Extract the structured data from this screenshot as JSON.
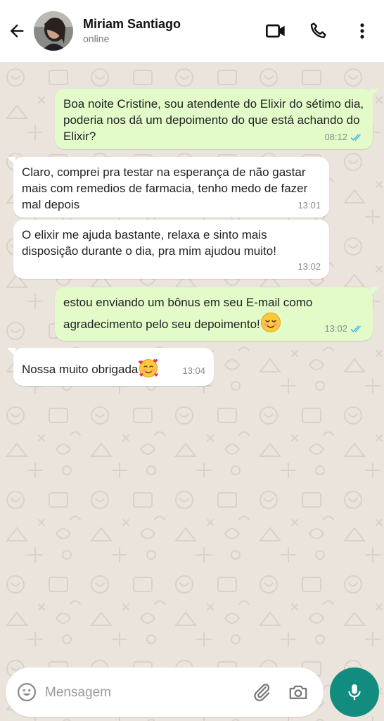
{
  "header": {
    "contact_name": "Miriam Santiago",
    "status": "online"
  },
  "messages": [
    {
      "direction": "outgoing",
      "text": "Boa noite Cristine, sou atendente do Elixir do sétimo dia, poderia nos dá um depoimento do que está achando do Elixir?",
      "time": "08:12",
      "read": true
    },
    {
      "direction": "incoming",
      "text": "Claro, comprei pra testar na esperança de não gastar mais com remedios de farmacia, tenho medo de fazer mal depois",
      "time": "13:01"
    },
    {
      "direction": "incoming",
      "text": "O elixir me ajuda bastante, relaxa e sinto mais disposição durante o dia, pra mim ajudou muito!",
      "time": "13:02"
    },
    {
      "direction": "outgoing",
      "text": " estou enviando um bônus em seu E-mail como agradecimento pelo seu depoimento!",
      "emoji": "☺️",
      "time": "13:02",
      "read": true
    },
    {
      "direction": "incoming",
      "text": "Nossa muito obrigada",
      "emoji": "🥰",
      "time": "13:04"
    }
  ],
  "input": {
    "placeholder": "Mensagem"
  },
  "icons": {
    "back": "arrow-left-icon",
    "video": "video-call-icon",
    "call": "phone-icon",
    "menu": "more-vertical-icon",
    "emoji": "emoji-icon",
    "attach": "paperclip-icon",
    "camera": "camera-icon",
    "mic": "microphone-icon",
    "read_receipt": "double-check-icon"
  },
  "colors": {
    "outgoing_bubble": "#E2FBC9",
    "incoming_bubble": "#FFFFFF",
    "wallpaper": "#EAE4DC",
    "mic_button": "#128C7E",
    "read_ticks": "#4FB6EC"
  }
}
